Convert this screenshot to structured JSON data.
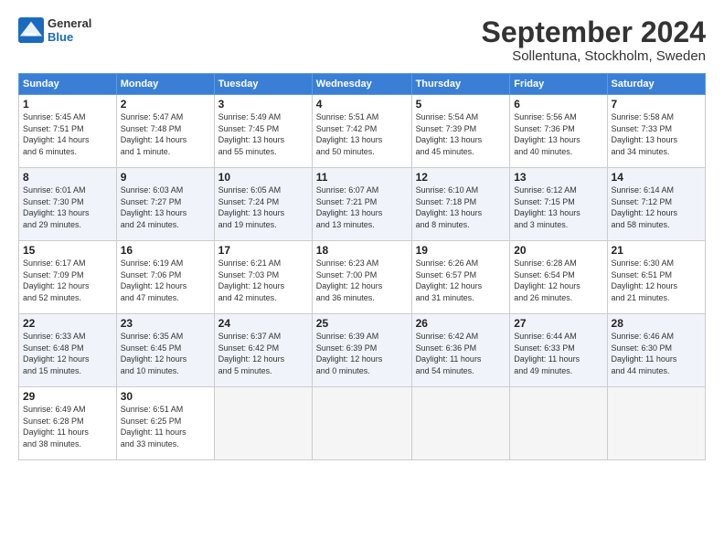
{
  "logo": {
    "general": "General",
    "blue": "Blue"
  },
  "header": {
    "month": "September 2024",
    "location": "Sollentuna, Stockholm, Sweden"
  },
  "weekdays": [
    "Sunday",
    "Monday",
    "Tuesday",
    "Wednesday",
    "Thursday",
    "Friday",
    "Saturday"
  ],
  "weeks": [
    [
      {
        "day": "1",
        "sunrise": "5:45 AM",
        "sunset": "7:51 PM",
        "daylight": "14 hours and 6 minutes."
      },
      {
        "day": "2",
        "sunrise": "5:47 AM",
        "sunset": "7:48 PM",
        "daylight": "14 hours and 1 minute."
      },
      {
        "day": "3",
        "sunrise": "5:49 AM",
        "sunset": "7:45 PM",
        "daylight": "13 hours and 55 minutes."
      },
      {
        "day": "4",
        "sunrise": "5:51 AM",
        "sunset": "7:42 PM",
        "daylight": "13 hours and 50 minutes."
      },
      {
        "day": "5",
        "sunrise": "5:54 AM",
        "sunset": "7:39 PM",
        "daylight": "13 hours and 45 minutes."
      },
      {
        "day": "6",
        "sunrise": "5:56 AM",
        "sunset": "7:36 PM",
        "daylight": "13 hours and 40 minutes."
      },
      {
        "day": "7",
        "sunrise": "5:58 AM",
        "sunset": "7:33 PM",
        "daylight": "13 hours and 34 minutes."
      }
    ],
    [
      {
        "day": "8",
        "sunrise": "6:01 AM",
        "sunset": "7:30 PM",
        "daylight": "13 hours and 29 minutes."
      },
      {
        "day": "9",
        "sunrise": "6:03 AM",
        "sunset": "7:27 PM",
        "daylight": "13 hours and 24 minutes."
      },
      {
        "day": "10",
        "sunrise": "6:05 AM",
        "sunset": "7:24 PM",
        "daylight": "13 hours and 19 minutes."
      },
      {
        "day": "11",
        "sunrise": "6:07 AM",
        "sunset": "7:21 PM",
        "daylight": "13 hours and 13 minutes."
      },
      {
        "day": "12",
        "sunrise": "6:10 AM",
        "sunset": "7:18 PM",
        "daylight": "13 hours and 8 minutes."
      },
      {
        "day": "13",
        "sunrise": "6:12 AM",
        "sunset": "7:15 PM",
        "daylight": "13 hours and 3 minutes."
      },
      {
        "day": "14",
        "sunrise": "6:14 AM",
        "sunset": "7:12 PM",
        "daylight": "12 hours and 58 minutes."
      }
    ],
    [
      {
        "day": "15",
        "sunrise": "6:17 AM",
        "sunset": "7:09 PM",
        "daylight": "12 hours and 52 minutes."
      },
      {
        "day": "16",
        "sunrise": "6:19 AM",
        "sunset": "7:06 PM",
        "daylight": "12 hours and 47 minutes."
      },
      {
        "day": "17",
        "sunrise": "6:21 AM",
        "sunset": "7:03 PM",
        "daylight": "12 hours and 42 minutes."
      },
      {
        "day": "18",
        "sunrise": "6:23 AM",
        "sunset": "7:00 PM",
        "daylight": "12 hours and 36 minutes."
      },
      {
        "day": "19",
        "sunrise": "6:26 AM",
        "sunset": "6:57 PM",
        "daylight": "12 hours and 31 minutes."
      },
      {
        "day": "20",
        "sunrise": "6:28 AM",
        "sunset": "6:54 PM",
        "daylight": "12 hours and 26 minutes."
      },
      {
        "day": "21",
        "sunrise": "6:30 AM",
        "sunset": "6:51 PM",
        "daylight": "12 hours and 21 minutes."
      }
    ],
    [
      {
        "day": "22",
        "sunrise": "6:33 AM",
        "sunset": "6:48 PM",
        "daylight": "12 hours and 15 minutes."
      },
      {
        "day": "23",
        "sunrise": "6:35 AM",
        "sunset": "6:45 PM",
        "daylight": "12 hours and 10 minutes."
      },
      {
        "day": "24",
        "sunrise": "6:37 AM",
        "sunset": "6:42 PM",
        "daylight": "12 hours and 5 minutes."
      },
      {
        "day": "25",
        "sunrise": "6:39 AM",
        "sunset": "6:39 PM",
        "daylight": "12 hours and 0 minutes."
      },
      {
        "day": "26",
        "sunrise": "6:42 AM",
        "sunset": "6:36 PM",
        "daylight": "11 hours and 54 minutes."
      },
      {
        "day": "27",
        "sunrise": "6:44 AM",
        "sunset": "6:33 PM",
        "daylight": "11 hours and 49 minutes."
      },
      {
        "day": "28",
        "sunrise": "6:46 AM",
        "sunset": "6:30 PM",
        "daylight": "11 hours and 44 minutes."
      }
    ],
    [
      {
        "day": "29",
        "sunrise": "6:49 AM",
        "sunset": "6:28 PM",
        "daylight": "11 hours and 38 minutes."
      },
      {
        "day": "30",
        "sunrise": "6:51 AM",
        "sunset": "6:25 PM",
        "daylight": "11 hours and 33 minutes."
      },
      null,
      null,
      null,
      null,
      null
    ]
  ],
  "labels": {
    "sunrise": "Sunrise:",
    "sunset": "Sunset:",
    "daylight": "Daylight:"
  }
}
